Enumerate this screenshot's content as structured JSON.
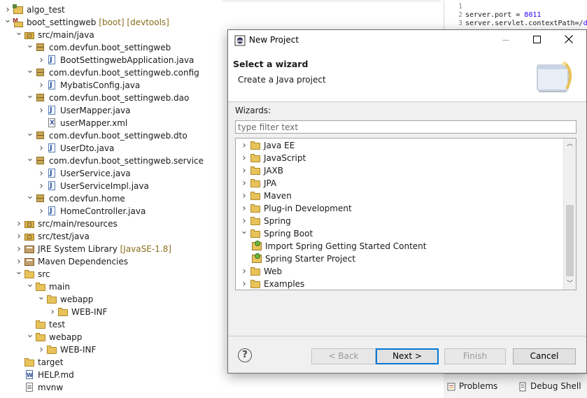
{
  "explorer": {
    "items": [
      {
        "label": "algo_test",
        "deco": "",
        "icon": "project-icon"
      },
      {
        "label": "boot_settingweb",
        "deco": " [boot] [devtools]",
        "icon": "maven-project-icon"
      },
      {
        "label": "src/main/java",
        "deco": "",
        "icon": "source-folder-icon"
      },
      {
        "label": "com.devfun.boot_settingweb",
        "deco": "",
        "icon": "package-icon"
      },
      {
        "label": "BootSettingwebApplication.java",
        "deco": "",
        "icon": "java-file-icon"
      },
      {
        "label": "com.devfun.boot_settingweb.config",
        "deco": "",
        "icon": "package-icon"
      },
      {
        "label": "MybatisConfig.java",
        "deco": "",
        "icon": "java-file-icon"
      },
      {
        "label": "com.devfun.boot_settingweb.dao",
        "deco": "",
        "icon": "package-icon"
      },
      {
        "label": "UserMapper.java",
        "deco": "",
        "icon": "java-file-icon"
      },
      {
        "label": "userMapper.xml",
        "deco": "",
        "icon": "xml-file-icon"
      },
      {
        "label": "com.devfun.boot_settingweb.dto",
        "deco": "",
        "icon": "package-icon"
      },
      {
        "label": "UserDto.java",
        "deco": "",
        "icon": "java-file-icon"
      },
      {
        "label": "com.devfun.boot_settingweb.service",
        "deco": "",
        "icon": "package-icon"
      },
      {
        "label": "UserService.java",
        "deco": "",
        "icon": "java-file-icon"
      },
      {
        "label": "UserServiceImpl.java",
        "deco": "",
        "icon": "java-file-icon"
      },
      {
        "label": "com.devfun.home",
        "deco": "",
        "icon": "package-icon"
      },
      {
        "label": "HomeController.java",
        "deco": "",
        "icon": "java-file-icon"
      },
      {
        "label": "src/main/resources",
        "deco": "",
        "icon": "source-folder-icon"
      },
      {
        "label": "src/test/java",
        "deco": "",
        "icon": "source-folder-icon"
      },
      {
        "label": "JRE System Library",
        "deco": " [JavaSE-1.8]",
        "icon": "library-icon"
      },
      {
        "label": "Maven Dependencies",
        "deco": "",
        "icon": "library-icon"
      },
      {
        "label": "src",
        "deco": "",
        "icon": "folder-icon"
      },
      {
        "label": "main",
        "deco": "",
        "icon": "folder-icon"
      },
      {
        "label": "webapp",
        "deco": "",
        "icon": "folder-icon"
      },
      {
        "label": "WEB-INF",
        "deco": "",
        "icon": "folder-icon"
      },
      {
        "label": "test",
        "deco": "",
        "icon": "folder-icon"
      },
      {
        "label": "webapp",
        "deco": "",
        "icon": "folder-icon"
      },
      {
        "label": "WEB-INF",
        "deco": "",
        "icon": "folder-icon"
      },
      {
        "label": "target",
        "deco": "",
        "icon": "folder-icon"
      },
      {
        "label": "HELP.md",
        "deco": "",
        "icon": "word-doc-icon"
      },
      {
        "label": "mvnw",
        "deco": "",
        "icon": "text-file-icon"
      }
    ]
  },
  "editor": {
    "lines": [
      {
        "num": "1",
        "key": "",
        "value": ""
      },
      {
        "num": "2",
        "key": "server.port = ",
        "value": "8011"
      },
      {
        "num": "3",
        "key": "server.servlet.contextPath=/",
        "value": "d"
      }
    ]
  },
  "bottom_panel": {
    "problems_label": "Problems",
    "debug_shell_label": "Debug Shell"
  },
  "dialog": {
    "title": "New Project",
    "banner_title": "Select a wizard",
    "banner_desc": "Create a Java project",
    "wizards_label": "Wizards:",
    "filter_placeholder": "type filter text",
    "tree": [
      {
        "label": "Java EE",
        "expanded": false,
        "child": false
      },
      {
        "label": "JavaScript",
        "expanded": false,
        "child": false
      },
      {
        "label": "JAXB",
        "expanded": false,
        "child": false
      },
      {
        "label": "JPA",
        "expanded": false,
        "child": false
      },
      {
        "label": "Maven",
        "expanded": false,
        "child": false
      },
      {
        "label": "Plug-in Development",
        "expanded": false,
        "child": false
      },
      {
        "label": "Spring",
        "expanded": false,
        "child": false
      },
      {
        "label": "Spring Boot",
        "expanded": true,
        "child": false
      },
      {
        "label": "Import Spring Getting Started Content",
        "expanded": false,
        "child": true
      },
      {
        "label": "Spring Starter Project",
        "expanded": false,
        "child": true
      },
      {
        "label": "Web",
        "expanded": false,
        "child": false
      },
      {
        "label": "Examples",
        "expanded": false,
        "child": false
      }
    ],
    "buttons": {
      "help": "?",
      "back": "< Back",
      "next": "Next >",
      "finish": "Finish",
      "cancel": "Cancel"
    }
  }
}
